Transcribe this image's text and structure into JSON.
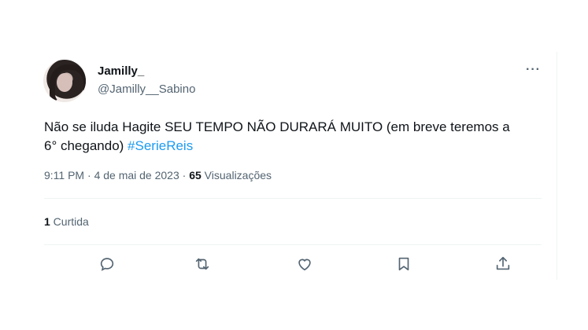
{
  "tweet": {
    "display_name": "Jamilly_",
    "handle": "@Jamilly__Sabino",
    "more_label": "···",
    "text": "Não se iluda Hagite SEU TEMPO NÃO DURARÁ MUITO (em breve teremos a 6° chegando) ",
    "hashtag": "#SerieReis",
    "time": "9:11 PM",
    "dot1": " · ",
    "date": "4 de mai de 2023",
    "dot2": " · ",
    "views_count": "65",
    "views_label": " Visualizações",
    "likes_count": "1",
    "likes_label": " Curtida"
  },
  "icons": [
    "reply-icon",
    "retweet-icon",
    "like-icon",
    "bookmark-icon",
    "share-icon"
  ],
  "colors": {
    "accent": "#1d9bf0",
    "muted": "#536471",
    "text": "#0f1419",
    "divider": "#eff3f4"
  }
}
